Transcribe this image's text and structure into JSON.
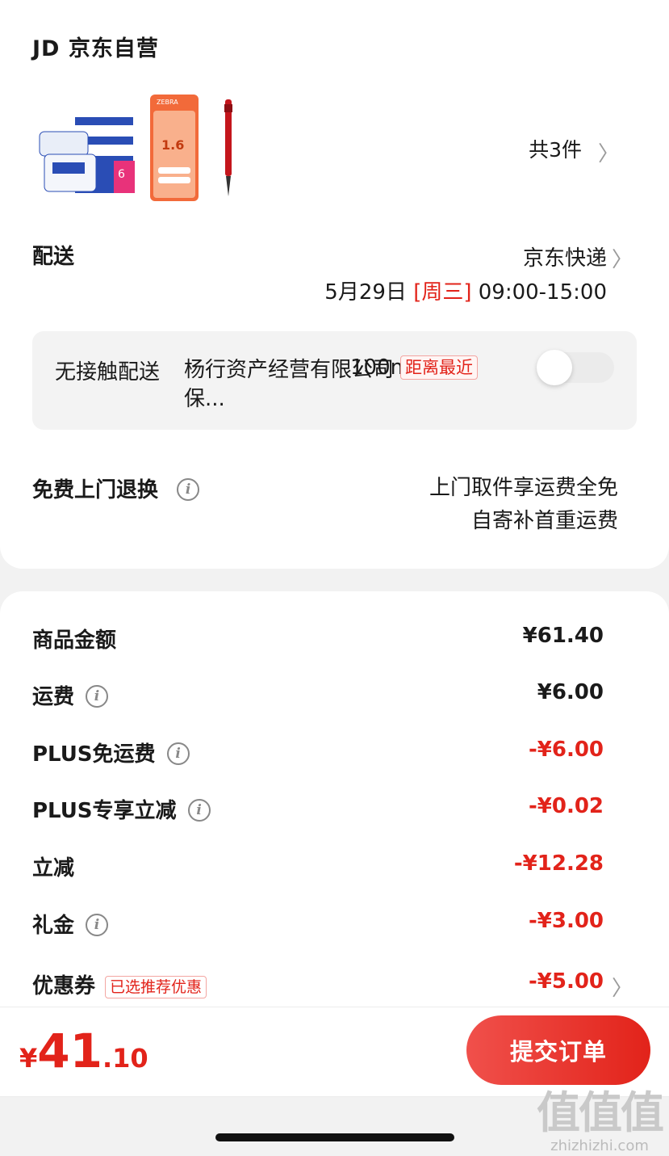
{
  "store": {
    "name": "JD 京东自营"
  },
  "products": {
    "items": [
      {
        "icon": "tissue-product-thumbnail"
      },
      {
        "icon": "zebra-promo-card-thumbnail"
      },
      {
        "icon": "red-pen-thumbnail"
      }
    ],
    "count_label": "共3件"
  },
  "delivery": {
    "label": "配送",
    "carrier": "京东快递",
    "date": "5月29日",
    "weekday": "[周三]",
    "window": "09:00-15:00"
  },
  "contactless": {
    "title": "无接触配送",
    "address": "杨行资产经营有限公司保...",
    "distance": "100m",
    "tag": "距离最近",
    "enabled": false
  },
  "returns": {
    "label": "免费上门退换",
    "note_line1": "上门取件享运费全免",
    "note_line2": "自寄补首重运费"
  },
  "fees": [
    {
      "label": "商品金额",
      "value": "¥61.40",
      "info": false
    },
    {
      "label": "运费",
      "value": "¥6.00",
      "info": true
    },
    {
      "label": "PLUS免运费",
      "value": "-¥6.00",
      "info": true
    },
    {
      "label": "PLUS专享立减",
      "value": "-¥0.02",
      "info": true
    },
    {
      "label": "立减",
      "value": "-¥12.28",
      "info": false
    },
    {
      "label": "礼金",
      "value": "-¥3.00",
      "info": true
    },
    {
      "label": "优惠券",
      "tag": "已选推荐优惠",
      "value": "-¥5.00",
      "info": false
    }
  ],
  "total": {
    "symbol": "¥",
    "integer": "41",
    "decimal": ".10"
  },
  "submit_label": "提交订单",
  "watermark": {
    "glyphs": "值值值",
    "url": "zhizhizhi.com"
  },
  "colors": {
    "accent": "#e2231a"
  }
}
